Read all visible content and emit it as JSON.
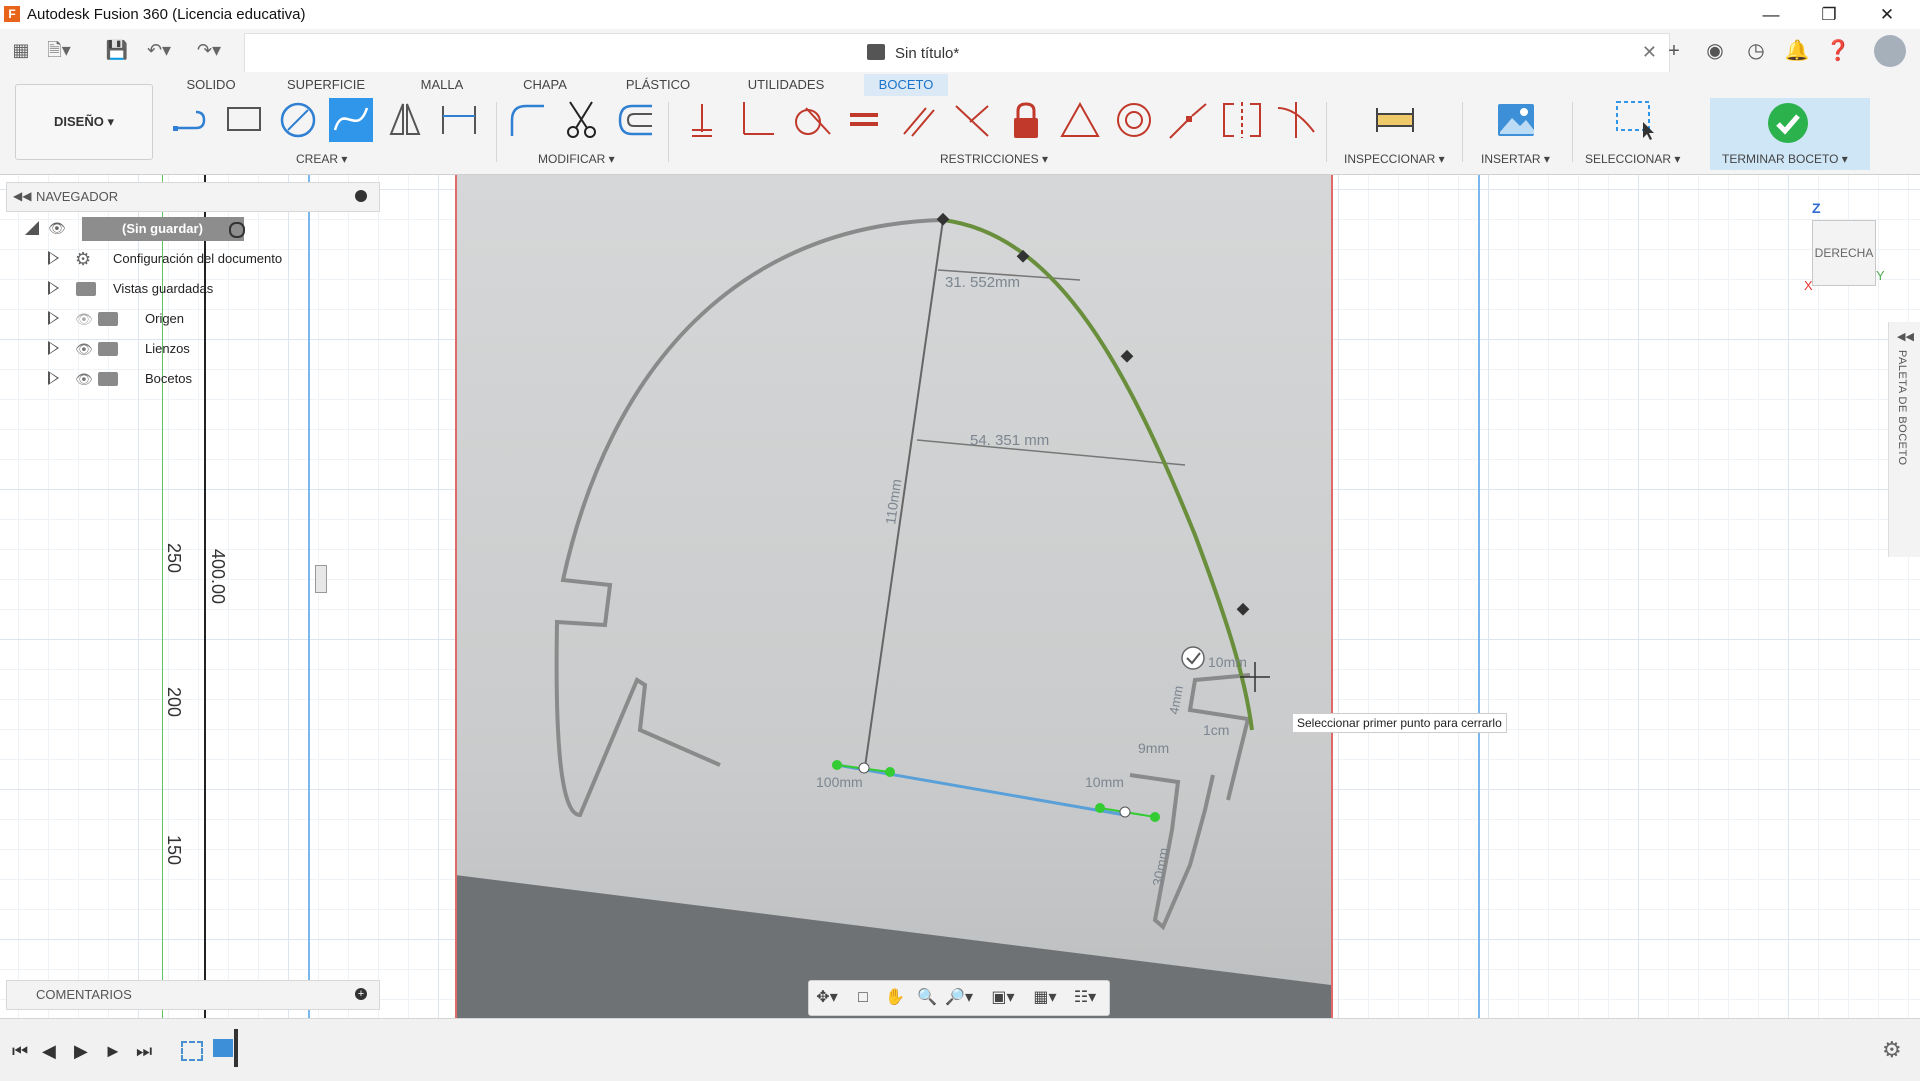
{
  "window": {
    "app_logo": "F",
    "title": "Autodesk Fusion 360 (Licencia educativa)",
    "controls": [
      "minimize-icon",
      "restore-icon",
      "close-icon"
    ]
  },
  "document": {
    "title": "Sin título*",
    "close": "✕"
  },
  "ribbon": {
    "workspace": "DISEÑO ▾",
    "tabs": [
      {
        "label": "SOLIDO",
        "active": false
      },
      {
        "label": "SUPERFICIE",
        "active": false
      },
      {
        "label": "MALLA",
        "active": false
      },
      {
        "label": "CHAPA",
        "active": false
      },
      {
        "label": "PLÁSTICO",
        "active": false
      },
      {
        "label": "UTILIDADES",
        "active": false
      },
      {
        "label": "BOCETO",
        "active": true
      }
    ],
    "groups": {
      "crear": "CREAR ▾",
      "modificar": "MODIFICAR ▾",
      "restricciones": "RESTRICCIONES ▾",
      "inspeccionar": "INSPECCIONAR ▾",
      "insertar": "INSERTAR ▾",
      "seleccionar": "SELECCIONAR ▾",
      "terminar": "TERMINAR BOCETO ▾"
    },
    "accent": "#2f96ea"
  },
  "navigator": {
    "title": "NAVEGADOR",
    "root": "(Sin guardar)",
    "items": [
      {
        "label": "Configuración del documento",
        "icon": "gear-icon"
      },
      {
        "label": "Vistas guardadas",
        "icon": "folder-icon"
      },
      {
        "label": "Origen",
        "icon": "folder-icon"
      },
      {
        "label": "Lienzos",
        "icon": "folder-icon"
      },
      {
        "label": "Bocetos",
        "icon": "folder-icon"
      }
    ]
  },
  "comments": {
    "title": "COMENTARIOS"
  },
  "ruler": {
    "labels": [
      "250",
      "200",
      "150"
    ],
    "dimension": "400.00"
  },
  "sketch_annotations": [
    "31. 552mm",
    "54. 351 mm",
    "10mm",
    "10mm",
    "4mm",
    "1cm",
    "9mm",
    "10mm",
    "100mm",
    "30mm",
    "110mm"
  ],
  "viewcube": {
    "face": "DERECHA",
    "axis_z": "Z",
    "axis_y": "Y",
    "axis_x": "X"
  },
  "palette": {
    "label": "PALETA DE BOCETO"
  },
  "tooltip": "Seleccionar primer punto para cerrarlo"
}
